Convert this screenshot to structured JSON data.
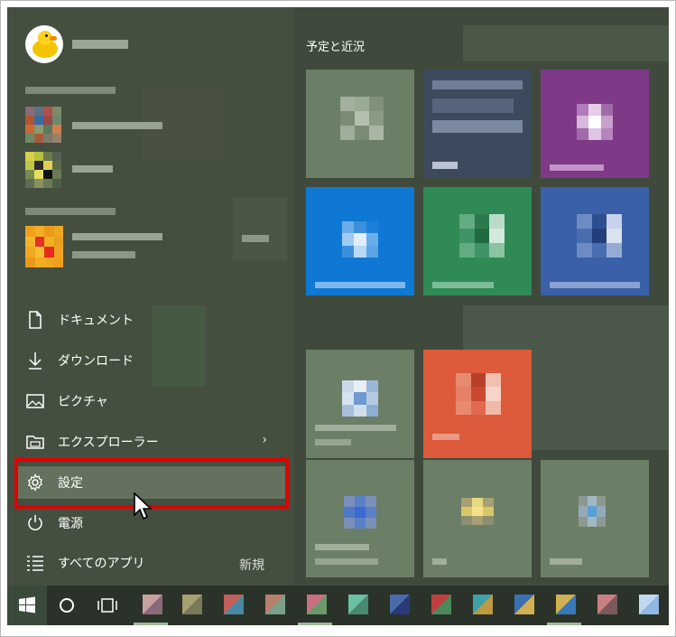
{
  "start_menu": {
    "section_title": "予定と近況",
    "nav": {
      "documents": "ドキュメント",
      "downloads": "ダウンロード",
      "pictures": "ピクチャ",
      "explorer": "エクスプローラー",
      "settings": "設定",
      "power": "電源",
      "all_apps": "すべてのアプリ",
      "new_badge": "新規"
    }
  },
  "colors": {
    "menu_bg": "#3f4a3d",
    "highlight": "#e00000",
    "tile_green": "#6b7f66",
    "tile_blue": "#0f78d4",
    "tile_purple": "#7e3a86",
    "tile_teal": "#2f8a55",
    "tile_navy": "#3a60a8",
    "tile_orange": "#dd5a3a",
    "taskbar": "#2a3229"
  },
  "icons": [
    "user-avatar-duck",
    "document-icon",
    "download-icon",
    "picture-icon",
    "explorer-folder-icon",
    "gear-icon",
    "power-icon",
    "list-icon",
    "windows-logo-icon",
    "cortana-circle-icon",
    "task-view-icon",
    "chevron-right-icon",
    "mouse-cursor-icon"
  ]
}
